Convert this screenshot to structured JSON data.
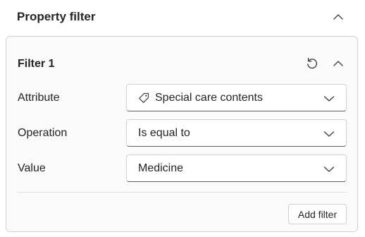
{
  "panel": {
    "title": "Property filter",
    "collapse_icon": "chevron-up-icon"
  },
  "filter": {
    "title": "Filter 1",
    "reset_icon": "reset-icon",
    "collapse_icon": "chevron-up-icon",
    "rows": [
      {
        "label": "Attribute",
        "value": "Special care contents",
        "icon": "tag-icon"
      },
      {
        "label": "Operation",
        "value": "Is equal to"
      },
      {
        "label": "Value",
        "value": "Medicine"
      }
    ],
    "add_button_label": "Add filter"
  }
}
